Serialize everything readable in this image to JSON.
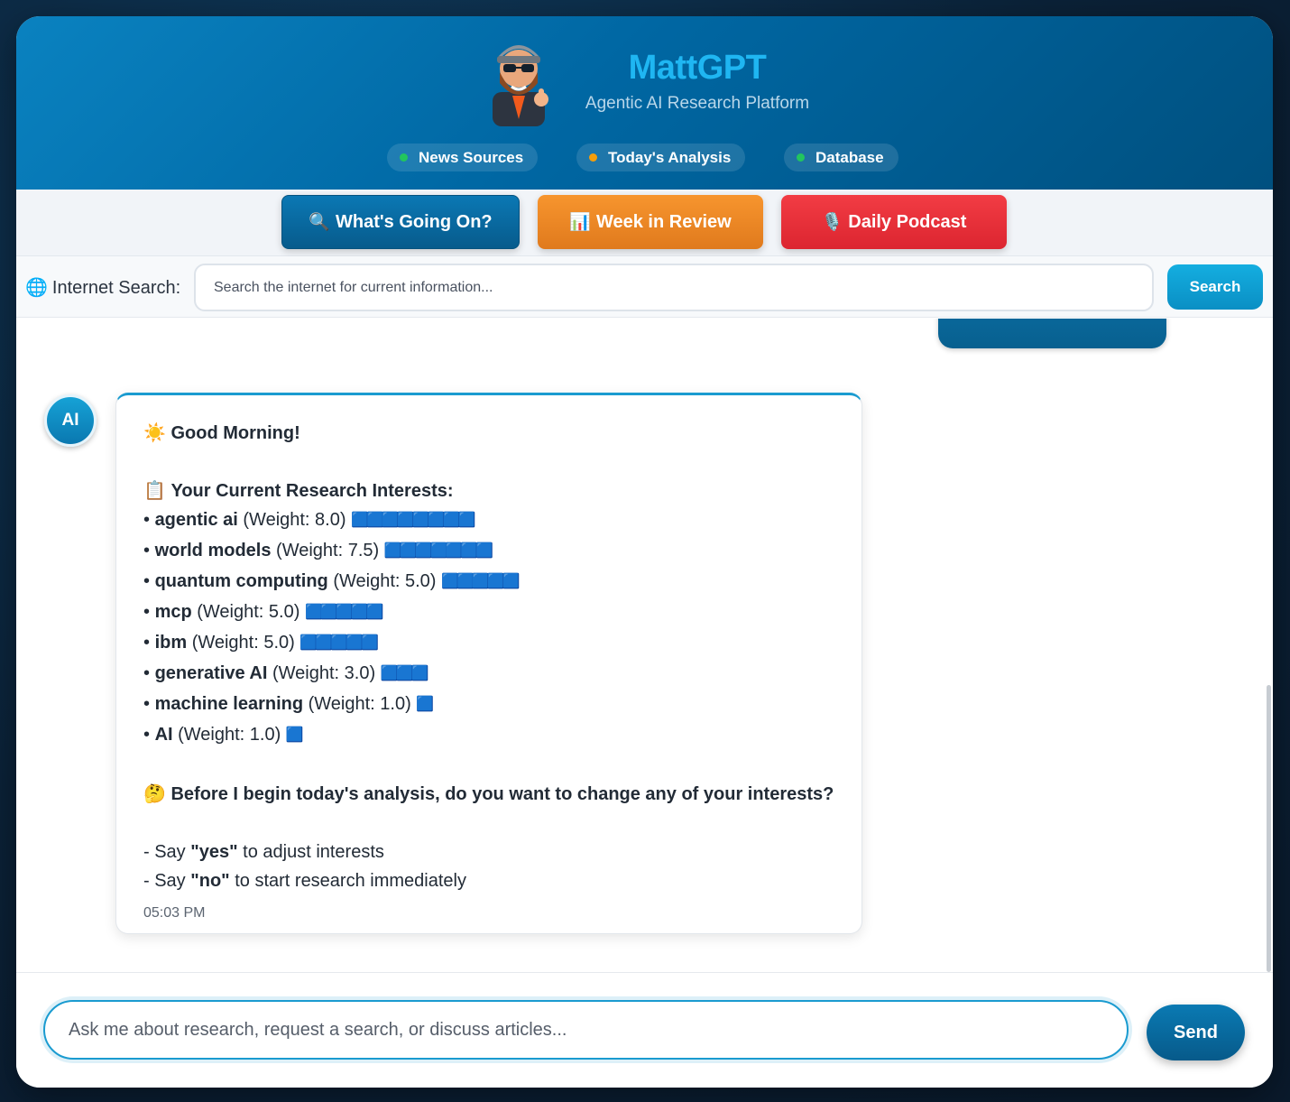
{
  "header": {
    "title": "MattGPT",
    "subtitle": "Agentic AI Research Platform",
    "status": [
      {
        "label": "News Sources",
        "color": "#22c55e"
      },
      {
        "label": "Today's Analysis",
        "color": "#f59e0b"
      },
      {
        "label": "Database",
        "color": "#22c55e"
      }
    ]
  },
  "actions": {
    "whats_going_on": {
      "emoji": "🔍",
      "label": "What's Going On?",
      "color": "#0b6fa6"
    },
    "week_in_review": {
      "emoji": "📊",
      "label": "Week in Review",
      "color": "#f08a24"
    },
    "daily_podcast": {
      "emoji": "🎙️",
      "label": "Daily Podcast",
      "color": "#e8333a"
    }
  },
  "internet_search": {
    "icon": "🌐",
    "label": "Internet Search:",
    "placeholder": "Search the internet for current information...",
    "button": "Search"
  },
  "chat": {
    "ai_avatar": "AI",
    "ai_message": {
      "greeting_emoji": "☀️",
      "greeting": "Good Morning!",
      "interests_emoji": "📋",
      "interests_heading": "Your Current Research Interests:",
      "interests": [
        {
          "name": "agentic ai",
          "weight": "(Weight: 8.0)",
          "bars": "🟦🟦🟦🟦🟦🟦🟦🟦"
        },
        {
          "name": "world models",
          "weight": "(Weight: 7.5)",
          "bars": "🟦🟦🟦🟦🟦🟦🟦"
        },
        {
          "name": "quantum computing",
          "weight": "(Weight: 5.0)",
          "bars": "🟦🟦🟦🟦🟦"
        },
        {
          "name": "mcp",
          "weight": "(Weight: 5.0)",
          "bars": "🟦🟦🟦🟦🟦"
        },
        {
          "name": "ibm",
          "weight": "(Weight: 5.0)",
          "bars": "🟦🟦🟦🟦🟦"
        },
        {
          "name": "generative AI",
          "weight": "(Weight: 3.0)",
          "bars": "🟦🟦🟦"
        },
        {
          "name": "machine learning",
          "weight": "(Weight: 1.0)",
          "bars": "🟦"
        },
        {
          "name": "AI",
          "weight": "(Weight: 1.0)",
          "bars": "🟦"
        }
      ],
      "question_emoji": "🤔",
      "question": "Before I begin today's analysis, do you want to change any of your interests?",
      "option_yes_prefix": "- Say ",
      "option_yes_word": "\"yes\"",
      "option_yes_suffix": " to adjust interests",
      "option_no_prefix": "- Say ",
      "option_no_word": "\"no\"",
      "option_no_suffix": " to start research immediately",
      "time": "05:03 PM"
    }
  },
  "composer": {
    "placeholder": "Ask me about research, request a search, or discuss articles...",
    "send": "Send"
  }
}
